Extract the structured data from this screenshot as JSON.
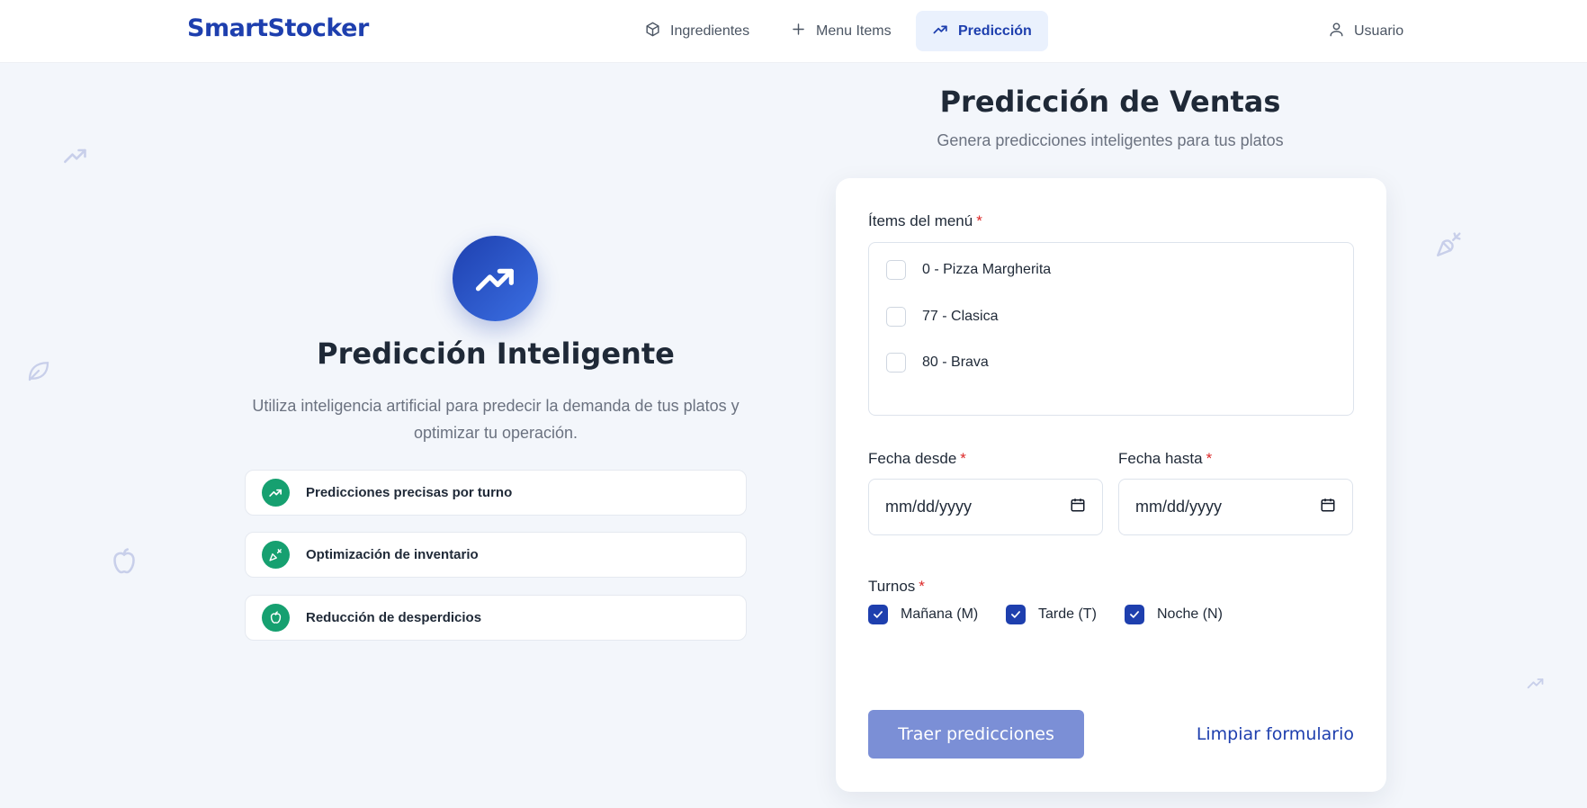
{
  "nav": {
    "brand": "SmartStocker",
    "items": [
      {
        "label": "Ingredientes",
        "icon": "box-icon"
      },
      {
        "label": "Menu Items",
        "icon": "plus-icon"
      },
      {
        "label": "Predicción",
        "icon": "trending-up-icon",
        "active": true
      }
    ],
    "user_label": "Usuario"
  },
  "hero": {
    "title": "Predicción Inteligente",
    "description": "Utiliza inteligencia artificial para predecir la demanda de tus platos y optimizar tu operación.",
    "features": [
      {
        "label": "Predicciones precisas por turno",
        "icon": "trending-up-icon"
      },
      {
        "label": "Optimización de inventario",
        "icon": "carrot-icon"
      },
      {
        "label": "Reducción de desperdicios",
        "icon": "apple-icon"
      }
    ]
  },
  "form": {
    "title": "Predicción de Ventas",
    "subtitle": "Genera predicciones inteligentes para tus platos",
    "items_label": "Ítems del menú",
    "required_mark": "*",
    "menu_items": [
      {
        "label": "0 - Pizza Margherita",
        "checked": false
      },
      {
        "label": "77 - Clasica",
        "checked": false
      },
      {
        "label": "80 - Brava",
        "checked": false
      }
    ],
    "date_from_label": "Fecha desde",
    "date_to_label": "Fecha hasta",
    "date_placeholder": "mm/dd/yyyy",
    "shifts_label": "Turnos",
    "shifts": [
      {
        "label": "Mañana (M)",
        "checked": true
      },
      {
        "label": "Tarde (T)",
        "checked": true
      },
      {
        "label": "Noche (N)",
        "checked": true
      }
    ],
    "submit_label": "Traer predicciones",
    "clear_label": "Limpiar formulario"
  },
  "colors": {
    "brand": "#1e3fae",
    "accent_green": "#16a070",
    "button_disabled": "#7b8fd6",
    "required": "#dc2626"
  }
}
